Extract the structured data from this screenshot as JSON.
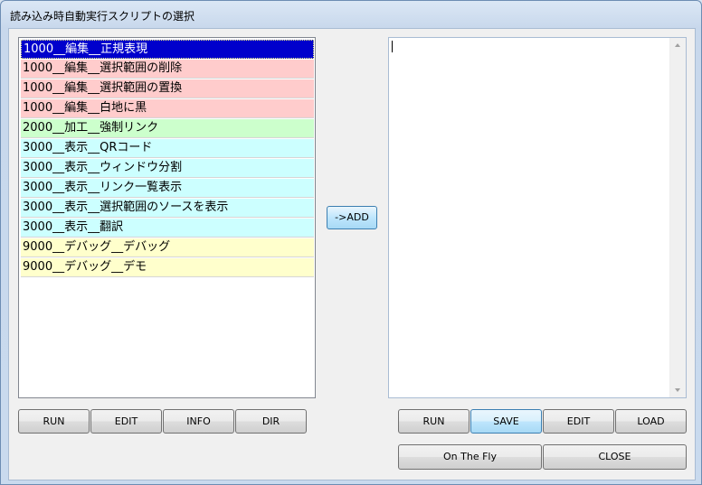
{
  "window": {
    "title": "読み込み時自動実行スクリプトの選択"
  },
  "script_list": {
    "items": [
      {
        "label": "1000__編集__正規表現",
        "color": "#0000cc",
        "selected": true
      },
      {
        "label": "1000__編集__選択範囲の削除",
        "color": "#ffcccc"
      },
      {
        "label": "1000__編集__選択範囲の置換",
        "color": "#ffcccc"
      },
      {
        "label": "1000__編集__白地に黒",
        "color": "#ffcccc"
      },
      {
        "label": "2000__加工__強制リンク",
        "color": "#ccffcc"
      },
      {
        "label": "3000__表示__QRコード",
        "color": "#ccffff"
      },
      {
        "label": "3000__表示__ウィンドウ分割",
        "color": "#ccffff"
      },
      {
        "label": "3000__表示__リンク一覧表示",
        "color": "#ccffff"
      },
      {
        "label": "3000__表示__選択範囲のソースを表示",
        "color": "#ccffff"
      },
      {
        "label": "3000__表示__翻訳",
        "color": "#ccffff"
      },
      {
        "label": "9000__デバッグ__デバッグ",
        "color": "#ffffcc"
      },
      {
        "label": "9000__デバッグ__デモ",
        "color": "#ffffcc"
      }
    ]
  },
  "add_button": "->ADD",
  "left_buttons": {
    "run": "RUN",
    "edit": "EDIT",
    "info": "INFO",
    "dir": "DIR"
  },
  "right_buttons": {
    "run": "RUN",
    "save": "SAVE",
    "edit": "EDIT",
    "load": "LOAD",
    "on_the_fly": "On The Fly",
    "close": "CLOSE"
  },
  "editor": {
    "value": ""
  },
  "icons": {
    "scroll_up": "scroll-up-arrow-icon",
    "scroll_down": "scroll-down-arrow-icon"
  }
}
